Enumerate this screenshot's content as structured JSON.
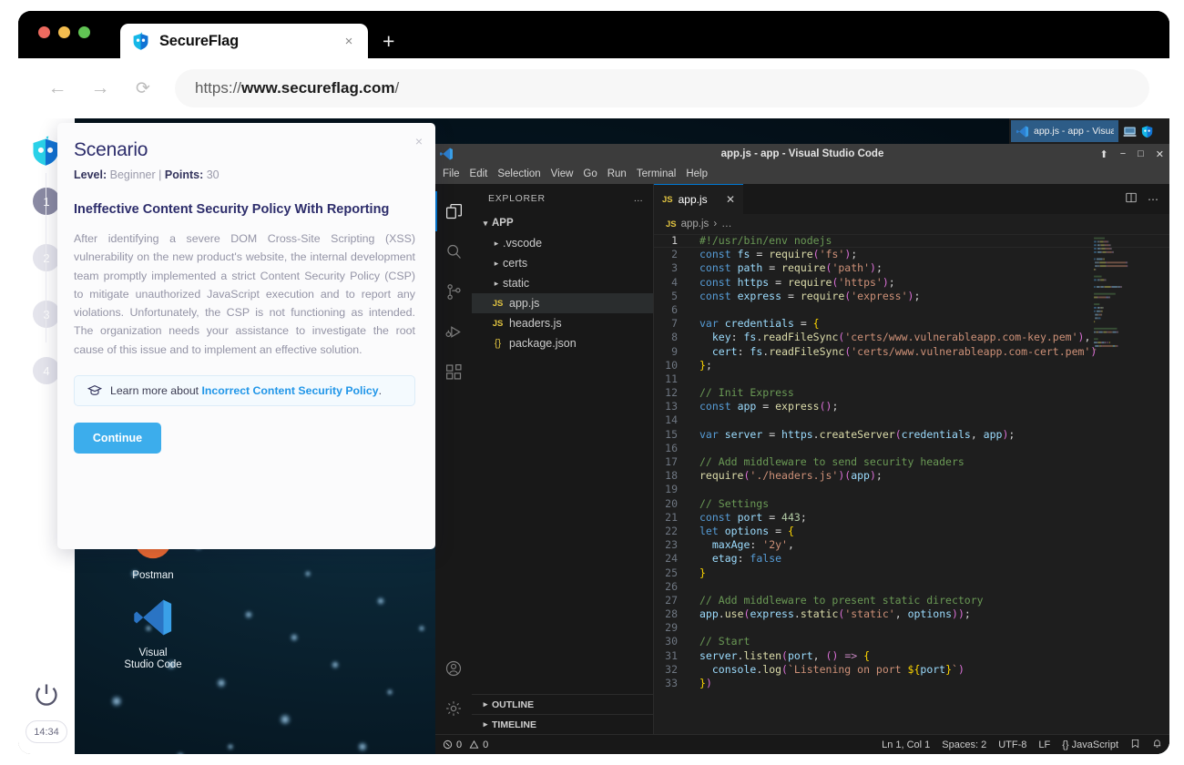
{
  "browser": {
    "tab_title": "SecureFlag",
    "tab_close": "×",
    "new_tab": "+",
    "back_icon": "←",
    "forward_icon": "→",
    "reload_icon": "⟳",
    "url_scheme": "https://",
    "url_host": "www.secureflag.com",
    "url_path": "/"
  },
  "scenario": {
    "title": "Scenario",
    "close": "×",
    "level_label": "Level:",
    "level_value": "Beginner",
    "separator": "|",
    "points_label": "Points:",
    "points_value": "30",
    "heading": "Ineffective Content Security Policy With Reporting",
    "description": "After identifying a severe DOM Cross-Site Scripting (XSS) vulnerability on the new product's website, the internal development team promptly implemented a strict Content Security Policy (CSP) to mitigate unauthorized JavaScript execution and to report any violations. Unfortunately, the CSP is not functioning as intended. The organization needs your assistance to investigate the root cause of this issue and to implement an effective solution.",
    "learn_prefix": "Learn more about",
    "learn_link": "Incorrect Content Security Policy",
    "learn_suffix": ".",
    "continue_label": "Continue"
  },
  "rail": {
    "steps": [
      {
        "number": "1",
        "active": true
      },
      {
        "number": "2",
        "active": false
      },
      {
        "number": "3",
        "active": false
      },
      {
        "number": "4",
        "active": false
      }
    ],
    "power_icon": "power-icon",
    "timer": "14:34"
  },
  "desktop": {
    "icons": [
      {
        "name": "Postman",
        "glyph": "postman-icon"
      },
      {
        "name": "Visual\nStudio Code",
        "glyph": "vscode-icon"
      }
    ]
  },
  "taskbar": {
    "window_label": "app.js - app - Visual Stu...",
    "tray": [
      "monitor-icon",
      "secureflag-icon"
    ]
  },
  "vscode": {
    "title": "app.js - app - Visual Studio Code",
    "window_controls": [
      "⬆",
      "−",
      "□",
      "✕"
    ],
    "menus": [
      "File",
      "Edit",
      "Selection",
      "View",
      "Go",
      "Run",
      "Terminal",
      "Help"
    ],
    "activity_icons": [
      {
        "name": "explorer-icon",
        "active": true
      },
      {
        "name": "search-icon",
        "active": false
      },
      {
        "name": "source-control-icon",
        "active": false
      },
      {
        "name": "run-debug-icon",
        "active": false
      },
      {
        "name": "extensions-icon",
        "active": false
      }
    ],
    "activity_bottom_icons": [
      "account-icon",
      "settings-gear-icon"
    ],
    "explorer": {
      "header": "EXPLORER",
      "header_more": "…",
      "root": "APP",
      "items": [
        {
          "label": ".vscode",
          "type": "folder"
        },
        {
          "label": "certs",
          "type": "folder"
        },
        {
          "label": "static",
          "type": "folder"
        },
        {
          "label": "app.js",
          "type": "js",
          "selected": true
        },
        {
          "label": "headers.js",
          "type": "js",
          "selected": false
        },
        {
          "label": "package.json",
          "type": "json",
          "selected": false
        }
      ],
      "sections": [
        "OUTLINE",
        "TIMELINE"
      ]
    },
    "editor": {
      "tab_label": "app.js",
      "tab_badge": "JS",
      "tab_close": "✕",
      "breadcrumb_badge": "JS",
      "breadcrumb_file": "app.js",
      "breadcrumb_sep": "›",
      "breadcrumb_more": "…",
      "split_icon": "split-editor-icon",
      "more_icon": "⋯"
    },
    "statusbar": {
      "errors_icon": "error-icon",
      "errors": "0",
      "warnings_icon": "warning-icon",
      "warnings": "0",
      "cursor": "Ln 1, Col 1",
      "spaces": "Spaces: 2",
      "encoding": "UTF-8",
      "eol": "LF",
      "language_badge": "{}",
      "language": "JavaScript",
      "feedback_icon": "feedback-icon",
      "bell_icon": "bell-icon"
    },
    "code": [
      {
        "n": "1",
        "tokens": [
          {
            "t": "comment",
            "v": "#!/usr/bin/env nodejs"
          }
        ]
      },
      {
        "n": "2",
        "tokens": [
          {
            "t": "key",
            "v": "const"
          },
          {
            "t": "plain",
            "v": " "
          },
          {
            "t": "var",
            "v": "fs"
          },
          {
            "t": "plain",
            "v": " = "
          },
          {
            "t": "fn",
            "v": "require"
          },
          {
            "t": "paren",
            "v": "("
          },
          {
            "t": "str",
            "v": "'fs'"
          },
          {
            "t": "paren",
            "v": ")"
          },
          {
            "t": "plain",
            "v": ";"
          }
        ]
      },
      {
        "n": "3",
        "tokens": [
          {
            "t": "key",
            "v": "const"
          },
          {
            "t": "plain",
            "v": " "
          },
          {
            "t": "var",
            "v": "path"
          },
          {
            "t": "plain",
            "v": " = "
          },
          {
            "t": "fn",
            "v": "require"
          },
          {
            "t": "paren",
            "v": "("
          },
          {
            "t": "str",
            "v": "'path'"
          },
          {
            "t": "paren",
            "v": ")"
          },
          {
            "t": "plain",
            "v": ";"
          }
        ]
      },
      {
        "n": "4",
        "tokens": [
          {
            "t": "key",
            "v": "const"
          },
          {
            "t": "plain",
            "v": " "
          },
          {
            "t": "var",
            "v": "https"
          },
          {
            "t": "plain",
            "v": " = "
          },
          {
            "t": "fn",
            "v": "require"
          },
          {
            "t": "paren",
            "v": "("
          },
          {
            "t": "str",
            "v": "'https'"
          },
          {
            "t": "paren",
            "v": ")"
          },
          {
            "t": "plain",
            "v": ";"
          }
        ]
      },
      {
        "n": "5",
        "tokens": [
          {
            "t": "key",
            "v": "const"
          },
          {
            "t": "plain",
            "v": " "
          },
          {
            "t": "var",
            "v": "express"
          },
          {
            "t": "plain",
            "v": " = "
          },
          {
            "t": "fn",
            "v": "require"
          },
          {
            "t": "paren",
            "v": "("
          },
          {
            "t": "str",
            "v": "'express'"
          },
          {
            "t": "paren",
            "v": ")"
          },
          {
            "t": "plain",
            "v": ";"
          }
        ]
      },
      {
        "n": "6",
        "tokens": []
      },
      {
        "n": "7",
        "tokens": [
          {
            "t": "key",
            "v": "var"
          },
          {
            "t": "plain",
            "v": " "
          },
          {
            "t": "var",
            "v": "credentials"
          },
          {
            "t": "plain",
            "v": " = "
          },
          {
            "t": "brace",
            "v": "{"
          }
        ]
      },
      {
        "n": "8",
        "tokens": [
          {
            "t": "plain",
            "v": "  "
          },
          {
            "t": "var",
            "v": "key"
          },
          {
            "t": "plain",
            "v": ": "
          },
          {
            "t": "var",
            "v": "fs"
          },
          {
            "t": "plain",
            "v": "."
          },
          {
            "t": "fn",
            "v": "readFileSync"
          },
          {
            "t": "paren",
            "v": "("
          },
          {
            "t": "str",
            "v": "'certs/www.vulnerableapp.com-key.pem'"
          },
          {
            "t": "paren",
            "v": ")"
          },
          {
            "t": "plain",
            "v": ","
          }
        ]
      },
      {
        "n": "9",
        "tokens": [
          {
            "t": "plain",
            "v": "  "
          },
          {
            "t": "var",
            "v": "cert"
          },
          {
            "t": "plain",
            "v": ": "
          },
          {
            "t": "var",
            "v": "fs"
          },
          {
            "t": "plain",
            "v": "."
          },
          {
            "t": "fn",
            "v": "readFileSync"
          },
          {
            "t": "paren",
            "v": "("
          },
          {
            "t": "str",
            "v": "'certs/www.vulnerableapp.com-cert.pem'"
          },
          {
            "t": "paren",
            "v": ")"
          }
        ]
      },
      {
        "n": "10",
        "tokens": [
          {
            "t": "brace",
            "v": "}"
          },
          {
            "t": "plain",
            "v": ";"
          }
        ]
      },
      {
        "n": "11",
        "tokens": []
      },
      {
        "n": "12",
        "tokens": [
          {
            "t": "comment",
            "v": "// Init Express"
          }
        ]
      },
      {
        "n": "13",
        "tokens": [
          {
            "t": "key",
            "v": "const"
          },
          {
            "t": "plain",
            "v": " "
          },
          {
            "t": "var",
            "v": "app"
          },
          {
            "t": "plain",
            "v": " = "
          },
          {
            "t": "fn",
            "v": "express"
          },
          {
            "t": "paren",
            "v": "()"
          },
          {
            "t": "plain",
            "v": ";"
          }
        ]
      },
      {
        "n": "14",
        "tokens": []
      },
      {
        "n": "15",
        "tokens": [
          {
            "t": "key",
            "v": "var"
          },
          {
            "t": "plain",
            "v": " "
          },
          {
            "t": "var",
            "v": "server"
          },
          {
            "t": "plain",
            "v": " = "
          },
          {
            "t": "var",
            "v": "https"
          },
          {
            "t": "plain",
            "v": "."
          },
          {
            "t": "fn",
            "v": "createServer"
          },
          {
            "t": "paren",
            "v": "("
          },
          {
            "t": "var",
            "v": "credentials"
          },
          {
            "t": "plain",
            "v": ", "
          },
          {
            "t": "var",
            "v": "app"
          },
          {
            "t": "paren",
            "v": ")"
          },
          {
            "t": "plain",
            "v": ";"
          }
        ]
      },
      {
        "n": "16",
        "tokens": []
      },
      {
        "n": "17",
        "tokens": [
          {
            "t": "comment",
            "v": "// Add middleware to send security headers"
          }
        ]
      },
      {
        "n": "18",
        "tokens": [
          {
            "t": "fn",
            "v": "require"
          },
          {
            "t": "paren",
            "v": "("
          },
          {
            "t": "str",
            "v": "'./headers.js'"
          },
          {
            "t": "paren",
            "v": ")("
          },
          {
            "t": "var",
            "v": "app"
          },
          {
            "t": "paren",
            "v": ")"
          },
          {
            "t": "plain",
            "v": ";"
          }
        ]
      },
      {
        "n": "19",
        "tokens": []
      },
      {
        "n": "20",
        "tokens": [
          {
            "t": "comment",
            "v": "// Settings"
          }
        ]
      },
      {
        "n": "21",
        "tokens": [
          {
            "t": "key",
            "v": "const"
          },
          {
            "t": "plain",
            "v": " "
          },
          {
            "t": "var",
            "v": "port"
          },
          {
            "t": "plain",
            "v": " = "
          },
          {
            "t": "num",
            "v": "443"
          },
          {
            "t": "plain",
            "v": ";"
          }
        ]
      },
      {
        "n": "22",
        "tokens": [
          {
            "t": "key",
            "v": "let"
          },
          {
            "t": "plain",
            "v": " "
          },
          {
            "t": "var",
            "v": "options"
          },
          {
            "t": "plain",
            "v": " = "
          },
          {
            "t": "brace",
            "v": "{"
          }
        ]
      },
      {
        "n": "23",
        "tokens": [
          {
            "t": "plain",
            "v": "  "
          },
          {
            "t": "var",
            "v": "maxAge"
          },
          {
            "t": "plain",
            "v": ": "
          },
          {
            "t": "str",
            "v": "'2y'"
          },
          {
            "t": "plain",
            "v": ","
          }
        ]
      },
      {
        "n": "24",
        "tokens": [
          {
            "t": "plain",
            "v": "  "
          },
          {
            "t": "var",
            "v": "etag"
          },
          {
            "t": "plain",
            "v": ": "
          },
          {
            "t": "key",
            "v": "false"
          }
        ]
      },
      {
        "n": "25",
        "tokens": [
          {
            "t": "brace",
            "v": "}"
          }
        ]
      },
      {
        "n": "26",
        "tokens": []
      },
      {
        "n": "27",
        "tokens": [
          {
            "t": "comment",
            "v": "// Add middleware to present static directory"
          }
        ]
      },
      {
        "n": "28",
        "tokens": [
          {
            "t": "var",
            "v": "app"
          },
          {
            "t": "plain",
            "v": "."
          },
          {
            "t": "fn",
            "v": "use"
          },
          {
            "t": "paren",
            "v": "("
          },
          {
            "t": "var",
            "v": "express"
          },
          {
            "t": "plain",
            "v": "."
          },
          {
            "t": "fn",
            "v": "static"
          },
          {
            "t": "paren",
            "v": "("
          },
          {
            "t": "str",
            "v": "'static'"
          },
          {
            "t": "plain",
            "v": ", "
          },
          {
            "t": "var",
            "v": "options"
          },
          {
            "t": "paren",
            "v": "))"
          },
          {
            "t": "plain",
            "v": ";"
          }
        ]
      },
      {
        "n": "29",
        "tokens": []
      },
      {
        "n": "30",
        "tokens": [
          {
            "t": "comment",
            "v": "// Start"
          }
        ]
      },
      {
        "n": "31",
        "tokens": [
          {
            "t": "var",
            "v": "server"
          },
          {
            "t": "plain",
            "v": "."
          },
          {
            "t": "fn",
            "v": "listen"
          },
          {
            "t": "paren",
            "v": "("
          },
          {
            "t": "var",
            "v": "port"
          },
          {
            "t": "plain",
            "v": ", "
          },
          {
            "t": "paren",
            "v": "()"
          },
          {
            "t": "plain",
            "v": " "
          },
          {
            "t": "key2",
            "v": "=>"
          },
          {
            "t": "plain",
            "v": " "
          },
          {
            "t": "brace",
            "v": "{"
          }
        ]
      },
      {
        "n": "32",
        "tokens": [
          {
            "t": "plain",
            "v": "  "
          },
          {
            "t": "var",
            "v": "console"
          },
          {
            "t": "plain",
            "v": "."
          },
          {
            "t": "fn",
            "v": "log"
          },
          {
            "t": "paren",
            "v": "("
          },
          {
            "t": "str",
            "v": "`Listening on port "
          },
          {
            "t": "brace",
            "v": "${"
          },
          {
            "t": "var",
            "v": "port"
          },
          {
            "t": "brace",
            "v": "}"
          },
          {
            "t": "str",
            "v": "`"
          },
          {
            "t": "paren",
            "v": ")"
          }
        ]
      },
      {
        "n": "33",
        "tokens": [
          {
            "t": "brace",
            "v": "}"
          },
          {
            "t": "paren",
            "v": ")"
          }
        ]
      }
    ]
  },
  "colors": {
    "accent_blue": "#3cadec",
    "link_blue": "#2196e8",
    "heading_navy": "#2d2d6b",
    "vscode_bg": "#1e1e1e",
    "vscode_sidebar": "#181818",
    "vscode_titlebar": "#3c3c3c",
    "vscode_active_tab_border": "#0078d4"
  }
}
